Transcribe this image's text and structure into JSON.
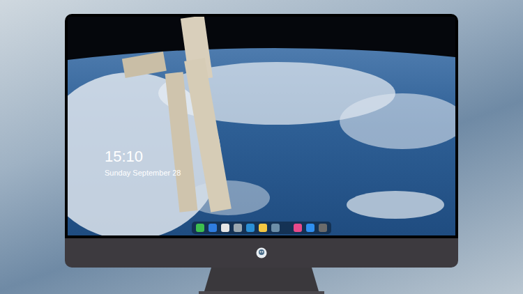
{
  "lock_screen": {
    "time": "15:10",
    "date": "Sunday September 28"
  },
  "dock": {
    "apps": [
      {
        "color": "#3dbf4f"
      },
      {
        "color": "#2f7de1"
      },
      {
        "color": "#e6e6e6"
      },
      {
        "color": "#9aa7b0"
      },
      {
        "color": "#2a8fd6"
      },
      {
        "color": "#f5c842"
      },
      {
        "color": "#6c8ea8"
      },
      {
        "color": "#e84a8a"
      },
      {
        "color": "#2f8ff0"
      },
      {
        "color": "#6b6b6b"
      }
    ]
  }
}
